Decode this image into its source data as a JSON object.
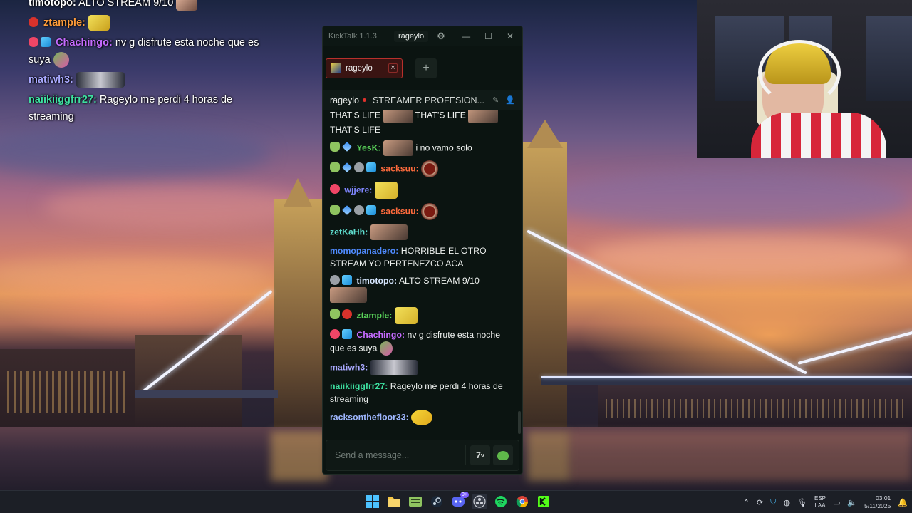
{
  "overlay_chat": [
    {
      "user": "timotopo:",
      "text": "ALTO STREAM 9/10",
      "color": "#ffffff"
    },
    {
      "user": "ztample:",
      "text": "",
      "color": "#ff9c3a"
    },
    {
      "user": "Chachingo:",
      "text": "nv g disfrute esta noche que es suya",
      "color": "#c56bff"
    },
    {
      "user": "matiwh3:",
      "text": "",
      "color": "#a9a9ff"
    },
    {
      "user": "naiikiiggfrr27:",
      "text": "Rageylo me perdi 4 horas de streaming",
      "color": "#3ddfa0"
    }
  ],
  "app": {
    "title": "KickTalk 1.1.3",
    "account": "rageylo",
    "tab_label": "rageylo",
    "tab_close": "×",
    "add_tab": "+",
    "streamer": "rageylo",
    "stream_title": "STREAMER PROFESION..."
  },
  "messages": [
    {
      "text_parts": [
        "THAT'S LIFE",
        "THAT'S LIFE",
        "THAT'S LIFE"
      ]
    },
    {
      "user": "YesK:",
      "text": "i no vamo solo",
      "color": "#5ad35a"
    },
    {
      "user": "sacksuu:",
      "text": "",
      "color": "#ff6b3d"
    },
    {
      "user": "wjjere:",
      "text": "",
      "color": "#7f86ff"
    },
    {
      "user": "sacksuu:",
      "text": "",
      "color": "#ff6b3d"
    },
    {
      "user": "zetKaHh:",
      "text": "",
      "color": "#5fdfd0"
    },
    {
      "user": "momopanadero:",
      "text": "HORRIBLE EL OTRO STREAM YO PERTENEZCO ACA",
      "color": "#4f8bff"
    },
    {
      "user": "timotopo:",
      "text": "ALTO STREAM 9/10",
      "color": "#d6e6ff"
    },
    {
      "user": "ztample:",
      "text": "",
      "color": "#5ad35a"
    },
    {
      "user": "Chachingo:",
      "text": "nv g disfrute esta noche que es suya",
      "color": "#c56bff"
    },
    {
      "user": "matiwh3:",
      "text": "",
      "color": "#a9a9ff"
    },
    {
      "user": "naiikiiggfrr27:",
      "text": "Rageylo me perdi 4 horas de streaming",
      "color": "#3ddfa0"
    },
    {
      "user": "racksonthefloor33:",
      "text": "",
      "color": "#9fb7ff"
    }
  ],
  "input": {
    "placeholder": "Send a message..."
  },
  "taskbar": {
    "discord_badge": "9+",
    "lang_top": "ESP",
    "lang_bottom": "LAA",
    "time": "03:01",
    "date": "5/11/2025"
  }
}
